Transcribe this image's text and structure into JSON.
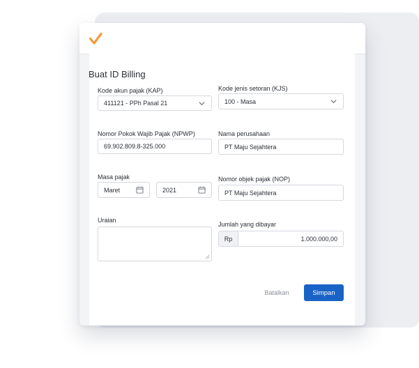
{
  "dialog": {
    "title": "Buat ID Billing"
  },
  "fields": {
    "kap": {
      "label": "Kode akun pajak (KAP)",
      "value": "411121 - PPh Pasal 21"
    },
    "kjs": {
      "label": "Kode jenis setoran (KJS)",
      "value": "100 - Masa"
    },
    "npwp": {
      "label": "Nomor Pokok Wajib Pajak (NPWP)",
      "value": "69.902.809.8-325.000"
    },
    "company": {
      "label": "Nama perusahaan",
      "value": "PT Maju Sejahtera"
    },
    "period": {
      "label": "Masa pajak",
      "month": "Maret",
      "year": "2021"
    },
    "nop": {
      "label": "Nomor objek pajak (NOP)",
      "value": "PT Maju Sejahtera"
    },
    "description": {
      "label": "Uraian",
      "value": ""
    },
    "amount": {
      "label": "Jumlah yang dibayar",
      "currency": "Rp",
      "value": "1.000.000,00"
    }
  },
  "actions": {
    "cancel": "Batalkan",
    "save": "Simpan"
  },
  "icons": {
    "logo": "checkmark-logo-icon",
    "dropdown": "chevron-down-icon",
    "calendar": "calendar-icon"
  },
  "colors": {
    "primary": "#1a63c6",
    "logo": "#f39a3b",
    "muted_text": "#8a8f98"
  }
}
